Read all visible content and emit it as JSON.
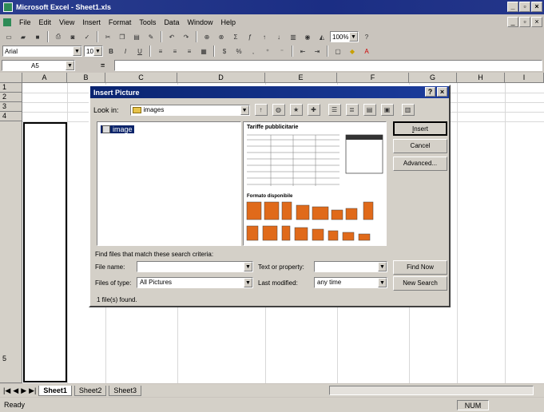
{
  "window": {
    "title": "Microsoft Excel - Sheet1.xls"
  },
  "menu": [
    "File",
    "Edit",
    "View",
    "Insert",
    "Format",
    "Tools",
    "Data",
    "Window",
    "Help"
  ],
  "toolbar": {
    "zoom": "100%",
    "font": "Arial",
    "size": "10"
  },
  "formula_bar": {
    "name_box": "A5",
    "equals": "="
  },
  "columns": [
    "A",
    "B",
    "C",
    "D",
    "E",
    "F",
    "G",
    "H",
    "I"
  ],
  "rows": [
    "1",
    "2",
    "3",
    "4",
    "5"
  ],
  "sheets": [
    "Sheet1",
    "Sheet2",
    "Sheet3"
  ],
  "status": {
    "ready": "Ready",
    "num": "NUM"
  },
  "dialog": {
    "title": "Insert Picture",
    "look_in_label": "Look in:",
    "look_in_value": "images",
    "file_item": "image",
    "preview_title": "Tariffe pubblicitarie",
    "preview_subtitle": "Formato disponibile",
    "buttons": {
      "insert": "Insert",
      "cancel": "Cancel",
      "advanced": "Advanced...",
      "find_now": "Find Now",
      "new_search": "New Search"
    },
    "criteria_label": "Find files that match these search criteria:",
    "file_name_label": "File name:",
    "file_name_value": "",
    "file_type_label": "Files of type:",
    "file_type_value": "All Pictures",
    "text_property_label": "Text or property:",
    "text_property_value": "",
    "last_modified_label": "Last modified:",
    "last_modified_value": "any time",
    "found_text": "1 file(s) found."
  }
}
